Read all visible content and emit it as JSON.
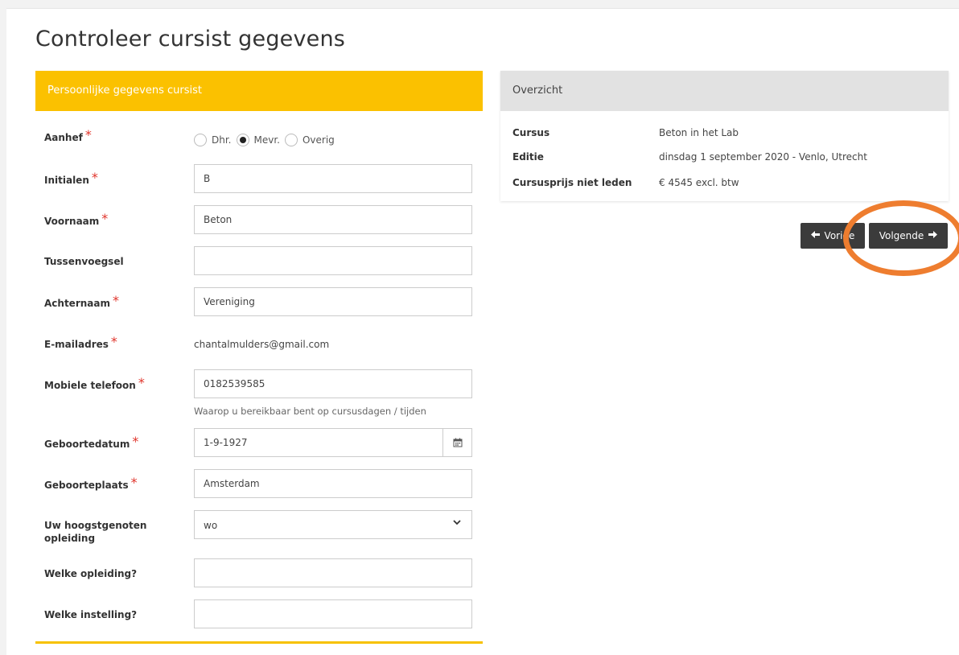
{
  "page": {
    "title": "Controleer cursist gegevens"
  },
  "form": {
    "header": "Persoonlijke gegevens cursist",
    "required_marker": "*",
    "aanhef": {
      "label": "Aanhef",
      "options": [
        "Dhr.",
        "Mevr.",
        "Overig"
      ],
      "selected": "Mevr."
    },
    "initialen": {
      "label": "Initialen",
      "value": "B"
    },
    "voornaam": {
      "label": "Voornaam",
      "value": "Beton"
    },
    "tussenvoegsel": {
      "label": "Tussenvoegsel",
      "value": ""
    },
    "achternaam": {
      "label": "Achternaam",
      "value": "Vereniging"
    },
    "email": {
      "label": "E-mailadres",
      "value": "chantalmulders@gmail.com"
    },
    "mobiel": {
      "label": "Mobiele telefoon",
      "value": "0182539585",
      "help": "Waarop u bereikbaar bent op cursusdagen / tijden"
    },
    "geboortedatum": {
      "label": "Geboortedatum",
      "value": "1-9-1927"
    },
    "geboorteplaats": {
      "label": "Geboorteplaats",
      "value": "Amsterdam"
    },
    "opleiding": {
      "label": "Uw hoogstgenoten opleiding",
      "value": "wo"
    },
    "welke_opleiding": {
      "label": "Welke opleiding?",
      "value": ""
    },
    "welke_instelling": {
      "label": "Welke instelling?",
      "value": ""
    }
  },
  "summary": {
    "header": "Overzicht",
    "rows": [
      {
        "label": "Cursus",
        "value": "Beton in het Lab"
      },
      {
        "label": "Editie",
        "value": "dinsdag 1 september 2020 - Venlo, Utrecht"
      },
      {
        "label": "Cursusprijs niet leden",
        "value": "€ 4545 excl. btw"
      }
    ]
  },
  "nav": {
    "prev_label": "Vorige",
    "next_label": "Volgende"
  },
  "icons": {
    "prev": "arrow-left-icon",
    "next": "arrow-right-icon",
    "calendar": "calendar-icon",
    "select": "chevron-down-icon"
  },
  "colors": {
    "accent": "#fbc100",
    "annotation": "#ee7d2f",
    "button": "#3b3b3b",
    "required": "#e0342b"
  }
}
